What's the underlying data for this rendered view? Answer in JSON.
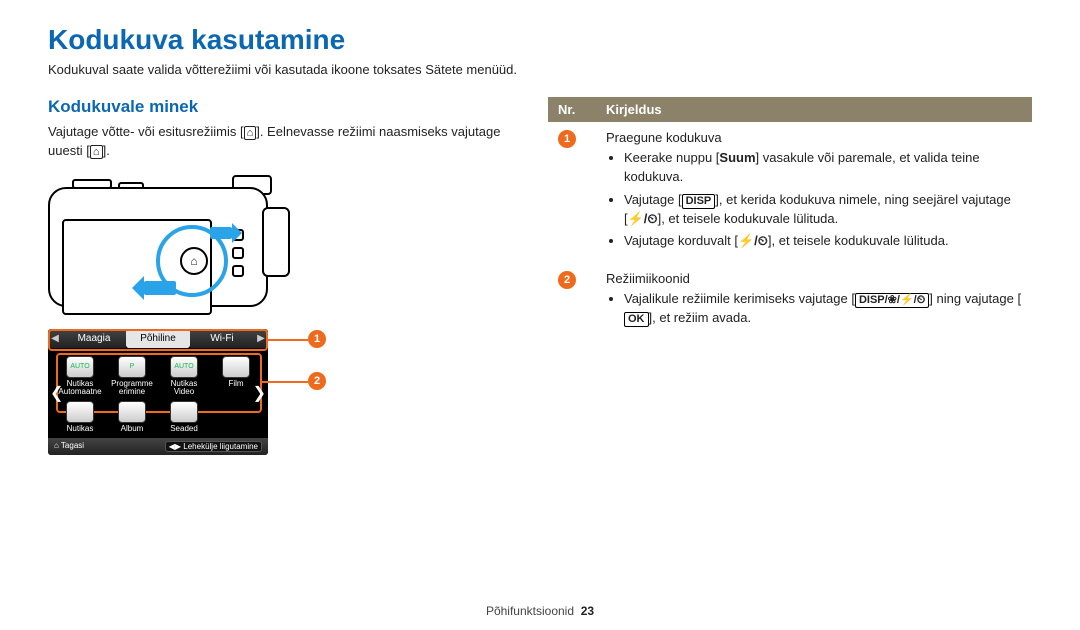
{
  "title": "Kodukuva kasutamine",
  "intro": "Kodukuval saate valida võtterežiimi või kasutada ikoone toksates Sätete menüüd.",
  "section_title": "Kodukuvale minek",
  "para1a": "Vajutage võtte- või esitusrežiimis [",
  "para1b": "]. Eelnevasse režiimi naasmiseks vajutage uuesti [",
  "para1c": "].",
  "home_glyph": "⌂",
  "ui": {
    "tabs": {
      "left_arrow": "◀",
      "right_arrow": "▶",
      "left": "Maagia",
      "center": "Põhiline",
      "right": "Wi-Fi"
    },
    "items": [
      {
        "label_a": "Nutikas",
        "label_b": "Automaatne",
        "badge": "AUTO"
      },
      {
        "label_a": "Programme",
        "label_b": "erimine",
        "badge": "P"
      },
      {
        "label_a": "Nutikas",
        "label_b": "Video",
        "badge": "AUTO"
      },
      {
        "label_a": "Film",
        "label_b": "",
        "badge": ""
      },
      {
        "label_a": "Nutikas",
        "label_b": "",
        "badge": ""
      },
      {
        "label_a": "Album",
        "label_b": "",
        "badge": ""
      },
      {
        "label_a": "Seaded",
        "label_b": "",
        "badge": ""
      }
    ],
    "footer_left_icon": "⌂",
    "footer_left": "Tagasi",
    "footer_right": "Lehekülje liigutamine"
  },
  "callouts": {
    "c1": "1",
    "c2": "2"
  },
  "tbl": {
    "hdr_nr": "Nr.",
    "hdr_desc": "Kirjeldus",
    "row1": {
      "num": "1",
      "title": "Praegune kodukuva",
      "b1a": "Keerake nuppu [",
      "b1suum": "Suum",
      "b1b": "] vasakule või paremale, et valida teine kodukuva.",
      "b2a": "Vajutage [",
      "b2disp": "DISP",
      "b2b": "], et kerida kodukuva nimele, ning seejärel vajutage [",
      "b2c": "], et teisele kodukuvale lülituda.",
      "flash_timer": "⚡/⏲",
      "b3a": "Vajutage korduvalt [",
      "b3b": "], et teisele kodukuvale lülituda."
    },
    "row2": {
      "num": "2",
      "title": "Režiimiikoonid",
      "b1a": "Vajalikule režiimile kerimiseks vajutage [",
      "navkeys": "DISP/❀/⚡/⏲",
      "b1b": "] ning vajutage [",
      "ok": "OK",
      "b1c": "], et režiim avada."
    }
  },
  "footer": {
    "text": "Põhifunktsioonid",
    "page": "23"
  },
  "chart_data": {
    "type": "table",
    "title": "Kirjeldus",
    "categories": [
      "1",
      "2"
    ],
    "values": [
      "Praegune kodukuva",
      "Režiimiikoonid"
    ]
  }
}
